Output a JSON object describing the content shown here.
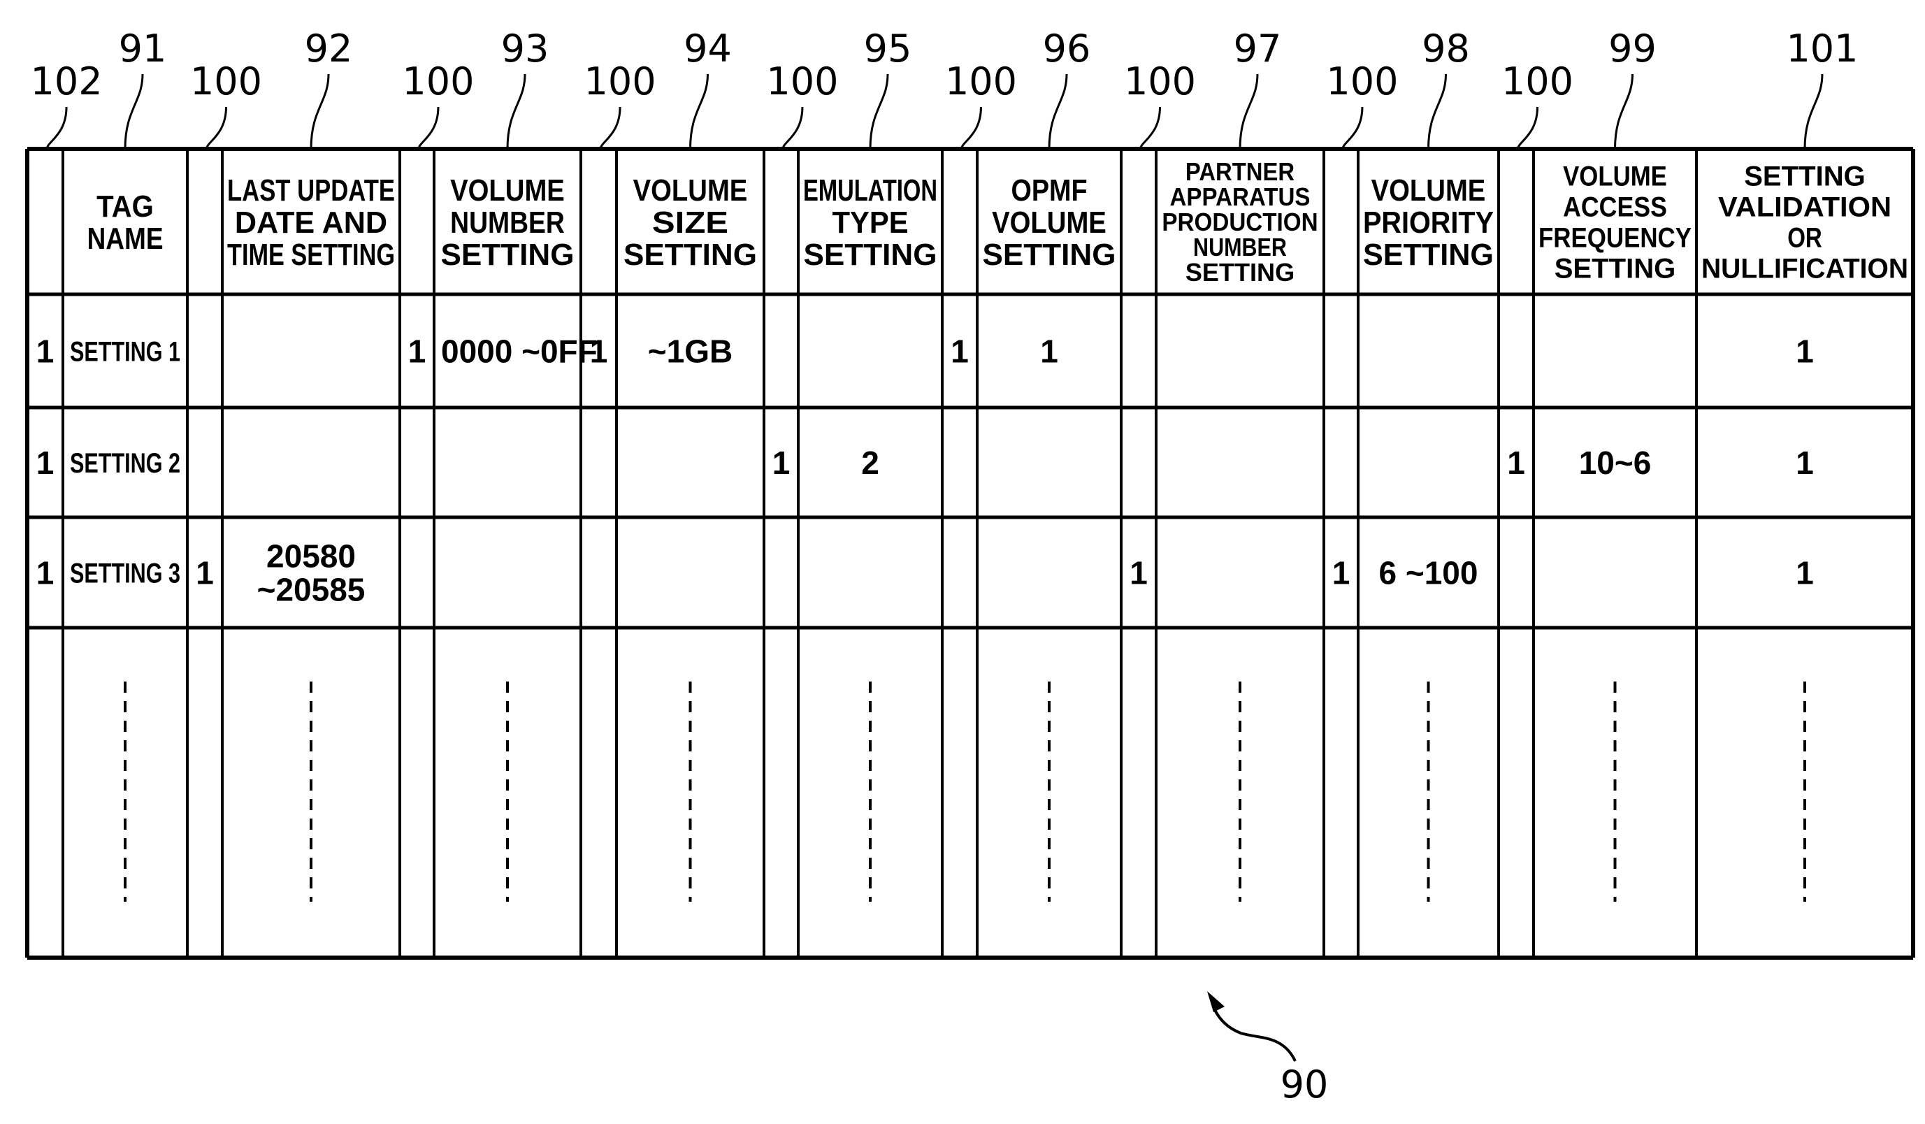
{
  "figure": {
    "reference_numeral": "90",
    "flag_column_ref": "100",
    "tag_flag_ref": "102",
    "columns": [
      {
        "ref": "102",
        "flag": true,
        "header": []
      },
      {
        "ref": "91",
        "flag": false,
        "header": [
          "TAG",
          "NAME"
        ]
      },
      {
        "ref": "100",
        "flag": true,
        "header": []
      },
      {
        "ref": "92",
        "flag": false,
        "header": [
          "LAST UPDATE",
          "DATE AND",
          "TIME SETTING"
        ]
      },
      {
        "ref": "100",
        "flag": true,
        "header": []
      },
      {
        "ref": "93",
        "flag": false,
        "header": [
          "VOLUME",
          "NUMBER",
          "SETTING"
        ]
      },
      {
        "ref": "100",
        "flag": true,
        "header": []
      },
      {
        "ref": "94",
        "flag": false,
        "header": [
          "VOLUME",
          "SIZE",
          "SETTING"
        ]
      },
      {
        "ref": "100",
        "flag": true,
        "header": []
      },
      {
        "ref": "95",
        "flag": false,
        "header": [
          "EMULATION",
          "TYPE",
          "SETTING"
        ]
      },
      {
        "ref": "100",
        "flag": true,
        "header": []
      },
      {
        "ref": "96",
        "flag": false,
        "header": [
          "OPMF",
          "VOLUME",
          "SETTING"
        ]
      },
      {
        "ref": "100",
        "flag": true,
        "header": []
      },
      {
        "ref": "97",
        "flag": false,
        "header": [
          "PARTNER",
          "APPARATUS",
          "PRODUCTION",
          "NUMBER",
          "SETTING"
        ]
      },
      {
        "ref": "100",
        "flag": true,
        "header": []
      },
      {
        "ref": "98",
        "flag": false,
        "header": [
          "VOLUME",
          "PRIORITY",
          "SETTING"
        ]
      },
      {
        "ref": "100",
        "flag": true,
        "header": []
      },
      {
        "ref": "99",
        "flag": false,
        "header": [
          "VOLUME",
          "ACCESS",
          "FREQUENCY",
          "SETTING"
        ]
      },
      {
        "ref": "101",
        "flag": false,
        "header": [
          "SETTING",
          "VALIDATION",
          "OR",
          "NULLIFICATION"
        ]
      }
    ],
    "rows": [
      [
        "1",
        "SETTING 1",
        "",
        "",
        "1",
        "0000 ~0FF",
        "1",
        "~1GB",
        "",
        "",
        "1",
        "1",
        "",
        "",
        "",
        "",
        "",
        "",
        "1"
      ],
      [
        "1",
        "SETTING 2",
        "",
        "",
        "",
        "",
        "",
        "",
        "1",
        "2",
        "",
        "",
        "",
        "",
        "",
        "",
        "1",
        "10~6",
        "1"
      ],
      [
        "1",
        "SETTING 3",
        "1",
        "20580\n~20585",
        "",
        "",
        "",
        "",
        "",
        "",
        "",
        "",
        "1",
        "",
        "1",
        "6 ~100",
        "",
        "",
        "1"
      ]
    ],
    "continuation_row": "dashed-ellipsis"
  }
}
